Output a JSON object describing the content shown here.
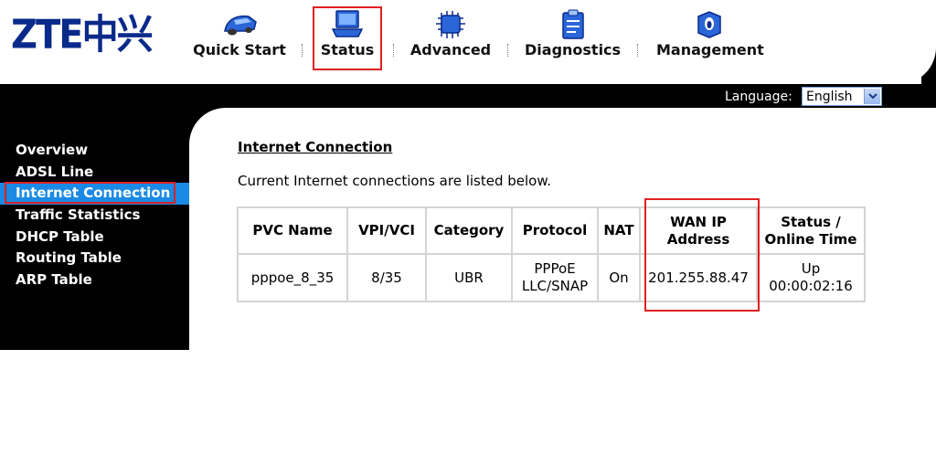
{
  "brand": {
    "logo": "ZTE中兴"
  },
  "nav": {
    "items": [
      {
        "label": "Quick Start",
        "icon": "car-icon"
      },
      {
        "label": "Status",
        "icon": "laptop-icon"
      },
      {
        "label": "Advanced",
        "icon": "chip-icon"
      },
      {
        "label": "Diagnostics",
        "icon": "clipboard-icon"
      },
      {
        "label": "Management",
        "icon": "cube-icon"
      }
    ],
    "active": "Status"
  },
  "language": {
    "label": "Language:",
    "value": "English"
  },
  "sidebar": {
    "items": [
      {
        "label": "Overview"
      },
      {
        "label": "ADSL Line"
      },
      {
        "label": "Internet Connection"
      },
      {
        "label": "Traffic Statistics"
      },
      {
        "label": "DHCP Table"
      },
      {
        "label": "Routing Table"
      },
      {
        "label": "ARP Table"
      }
    ],
    "active": "Internet Connection"
  },
  "main": {
    "title": "Internet Connection",
    "description": "Current Internet connections are listed below.",
    "table": {
      "headers": {
        "pvc_name": "PVC Name",
        "vpi_vci": "VPI/VCI",
        "category": "Category",
        "protocol": "Protocol",
        "nat": "NAT",
        "wan_ip_line1": "WAN IP",
        "wan_ip_line2": "Address",
        "status_line1": "Status /",
        "status_line2": "Online Time"
      },
      "rows": [
        {
          "pvc_name": "pppoe_8_35",
          "vpi_vci": "8/35",
          "category": "UBR",
          "protocol_line1": "PPPoE",
          "protocol_line2": "LLC/SNAP",
          "nat": "On",
          "wan_ip": "201.255.88.47",
          "status": "Up",
          "online_time": "00:00:02:16"
        }
      ]
    }
  },
  "colors": {
    "accent_blue": "#1a8ae6",
    "highlight_red": "#e02020",
    "logo_blue": "#0a2a8a"
  }
}
